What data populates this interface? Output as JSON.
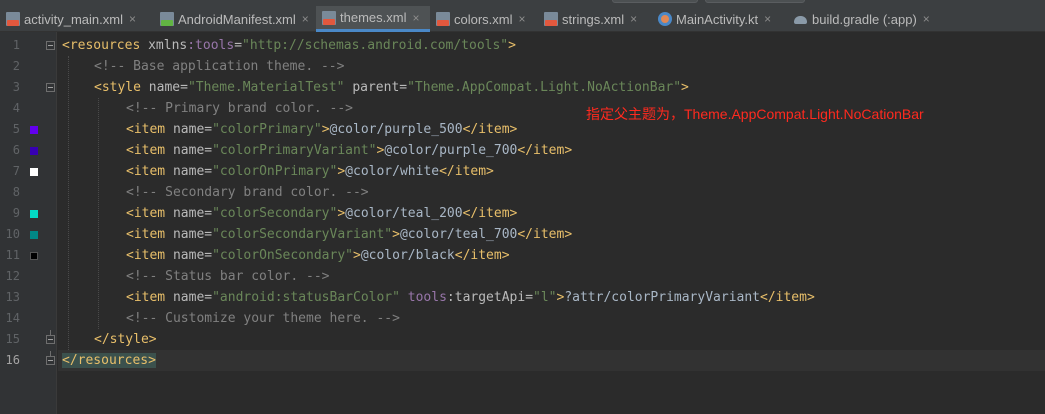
{
  "tabs": [
    {
      "label": "activity_main.xml",
      "icon": "xml-file-icon",
      "active": false
    },
    {
      "label": "AndroidManifest.xml",
      "icon": "manifest-file-icon",
      "active": false
    },
    {
      "label": "themes.xml",
      "icon": "xml-file-icon",
      "active": true
    },
    {
      "label": "colors.xml",
      "icon": "xml-file-icon",
      "active": false
    },
    {
      "label": "strings.xml",
      "icon": "xml-file-icon",
      "active": false
    },
    {
      "label": "MainActivity.kt",
      "icon": "kotlin-file-icon",
      "active": false
    },
    {
      "label": "build.gradle (:app)",
      "icon": "gradle-file-icon",
      "active": false
    }
  ],
  "close_glyph": "×",
  "editor": {
    "current_line": 16,
    "color_swatches": {
      "5": "#6200ee",
      "6": "#3700b3",
      "7": "#ffffff",
      "9": "#03dac5",
      "10": "#018786",
      "11": "#000000"
    },
    "lines": [
      {
        "n": "1",
        "parts": [
          [
            "t-tag",
            "<resources "
          ],
          [
            "t-attr",
            "xmlns"
          ],
          [
            "t-ns",
            ":tools"
          ],
          [
            "t-attr",
            "="
          ],
          [
            "t-str",
            "\"http://schemas.android.com/tools\""
          ],
          [
            "t-tag",
            ">"
          ]
        ]
      },
      {
        "n": "2",
        "parts": [
          [
            "t-cmt",
            "<!-- Base application theme. -->"
          ]
        ]
      },
      {
        "n": "3",
        "parts": [
          [
            "t-tag",
            "<style "
          ],
          [
            "t-attr",
            "name="
          ],
          [
            "t-str",
            "\"Theme.MaterialTest\" "
          ],
          [
            "t-attr",
            "parent="
          ],
          [
            "t-str",
            "\"Theme.AppCompat.Light.NoActionBar\""
          ],
          [
            "t-tag",
            ">"
          ]
        ]
      },
      {
        "n": "4",
        "parts": [
          [
            "t-cmt",
            "<!-- Primary brand color. -->"
          ]
        ]
      },
      {
        "n": "5",
        "parts": [
          [
            "t-tag",
            "<item "
          ],
          [
            "t-attr",
            "name="
          ],
          [
            "t-str",
            "\"colorPrimary\""
          ],
          [
            "t-tag",
            ">"
          ],
          [
            "t-txt",
            "@color/purple_500"
          ],
          [
            "t-tag",
            "</item>"
          ]
        ]
      },
      {
        "n": "6",
        "parts": [
          [
            "t-tag",
            "<item "
          ],
          [
            "t-attr",
            "name="
          ],
          [
            "t-str",
            "\"colorPrimaryVariant\""
          ],
          [
            "t-tag",
            ">"
          ],
          [
            "t-txt",
            "@color/purple_700"
          ],
          [
            "t-tag",
            "</item>"
          ]
        ]
      },
      {
        "n": "7",
        "parts": [
          [
            "t-tag",
            "<item "
          ],
          [
            "t-attr",
            "name="
          ],
          [
            "t-str",
            "\"colorOnPrimary\""
          ],
          [
            "t-tag",
            ">"
          ],
          [
            "t-txt",
            "@color/white"
          ],
          [
            "t-tag",
            "</item>"
          ]
        ]
      },
      {
        "n": "8",
        "parts": [
          [
            "t-cmt",
            "<!-- Secondary brand color. -->"
          ]
        ]
      },
      {
        "n": "9",
        "parts": [
          [
            "t-tag",
            "<item "
          ],
          [
            "t-attr",
            "name="
          ],
          [
            "t-str",
            "\"colorSecondary\""
          ],
          [
            "t-tag",
            ">"
          ],
          [
            "t-txt",
            "@color/teal_200"
          ],
          [
            "t-tag",
            "</item>"
          ]
        ]
      },
      {
        "n": "10",
        "parts": [
          [
            "t-tag",
            "<item "
          ],
          [
            "t-attr",
            "name="
          ],
          [
            "t-str",
            "\"colorSecondaryVariant\""
          ],
          [
            "t-tag",
            ">"
          ],
          [
            "t-txt",
            "@color/teal_700"
          ],
          [
            "t-tag",
            "</item>"
          ]
        ]
      },
      {
        "n": "11",
        "parts": [
          [
            "t-tag",
            "<item "
          ],
          [
            "t-attr",
            "name="
          ],
          [
            "t-str",
            "\"colorOnSecondary\""
          ],
          [
            "t-tag",
            ">"
          ],
          [
            "t-txt",
            "@color/black"
          ],
          [
            "t-tag",
            "</item>"
          ]
        ]
      },
      {
        "n": "12",
        "parts": [
          [
            "t-cmt",
            "<!-- Status bar color. -->"
          ]
        ]
      },
      {
        "n": "13",
        "parts": [
          [
            "t-tag",
            "<item "
          ],
          [
            "t-attr",
            "name="
          ],
          [
            "t-str",
            "\"android:statusBarColor\" "
          ],
          [
            "t-ns",
            "tools"
          ],
          [
            "t-attr",
            ":targetApi="
          ],
          [
            "t-str",
            "\"l\""
          ],
          [
            "t-tag",
            ">"
          ],
          [
            "t-txt",
            "?attr/colorPrimaryVariant"
          ],
          [
            "t-tag",
            "</item>"
          ]
        ]
      },
      {
        "n": "14",
        "parts": [
          [
            "t-cmt",
            "<!-- Customize your theme here. -->"
          ]
        ]
      },
      {
        "n": "15",
        "parts": [
          [
            "t-tag",
            "</style>"
          ]
        ]
      },
      {
        "n": "16",
        "parts": [
          [
            "t-tag brace-hl",
            "</resources>"
          ]
        ]
      }
    ]
  },
  "annotation": {
    "text": "指定父主题为，Theme.AppCompat.Light.NoCationBar",
    "color": "#ff2a1f"
  }
}
